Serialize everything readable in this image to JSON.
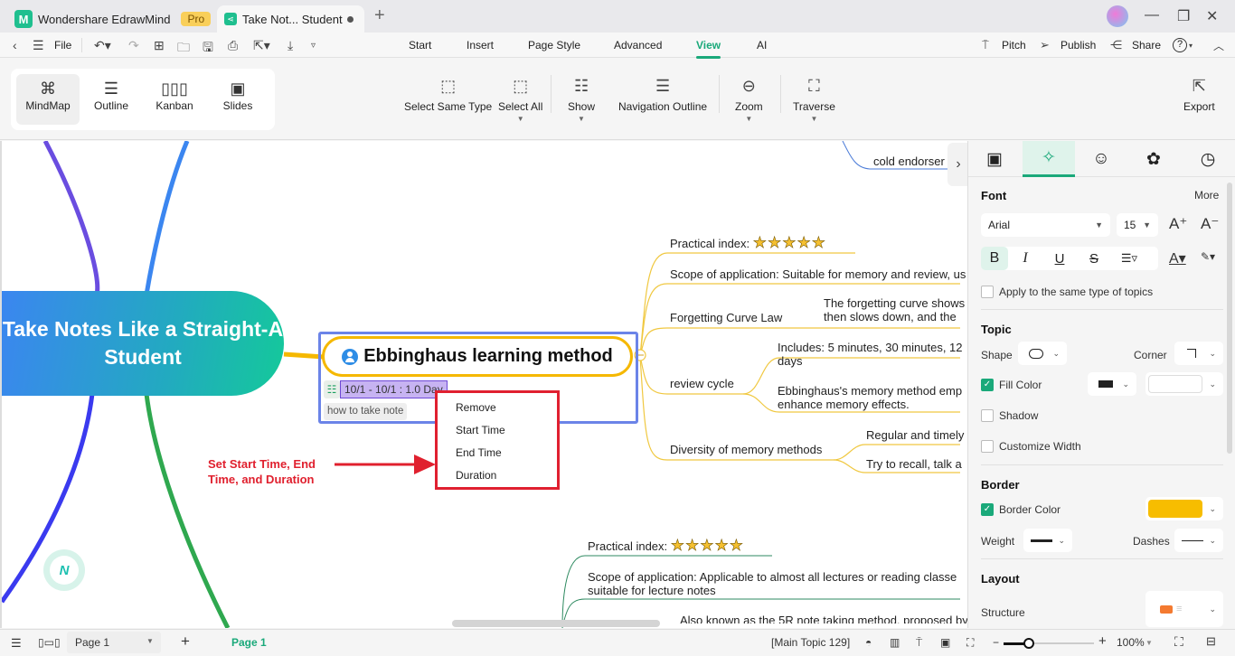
{
  "titlebar": {
    "app_name": "Wondershare EdrawMind",
    "pro_badge": "Pro",
    "doc_tab": "Take Not... Student",
    "new_tab": "+",
    "logo_letter": "M"
  },
  "menubar": {
    "file": "File",
    "tabs": [
      "Start",
      "Insert",
      "Page Style",
      "Advanced",
      "View",
      "AI"
    ],
    "active_tab": "View",
    "right": {
      "pitch": "Pitch",
      "publish": "Publish",
      "share": "Share",
      "help": "?"
    }
  },
  "ribbon": {
    "view_modes": [
      {
        "label": "MindMap",
        "icon": "mindmap-icon",
        "selected": true
      },
      {
        "label": "Outline",
        "icon": "outline-icon"
      },
      {
        "label": "Kanban",
        "icon": "kanban-icon"
      },
      {
        "label": "Slides",
        "icon": "slides-icon"
      }
    ],
    "tools": [
      {
        "label": "Select Same Type",
        "icon": "select-same-type-icon"
      },
      {
        "label": "Select All",
        "icon": "select-all-icon",
        "dropdown": true
      },
      {
        "label": "Show",
        "icon": "show-icon",
        "dropdown": true
      },
      {
        "label": "Navigation Outline",
        "icon": "navigation-outline-icon"
      },
      {
        "label": "Zoom",
        "icon": "zoom-icon",
        "dropdown": true
      },
      {
        "label": "Traverse",
        "icon": "traverse-icon",
        "dropdown": true
      }
    ],
    "export": "Export"
  },
  "canvas": {
    "central_topic": "Take Notes Like a Straight-A Student",
    "main_topic": "Ebbinghaus learning method",
    "date_range": "10/1 - 10/1 : 1.0 Day",
    "note_tag": "how to take note",
    "context_menu": [
      "Remove",
      "Start Time",
      "End Time",
      "Duration"
    ],
    "annotation": "Set Start Time, End Time, and Duration",
    "top_node": "cold endorser",
    "branch1": {
      "practical_label": "Practical index:",
      "rating": 5,
      "scope": "Scope of application: Suitable for memory and review, us",
      "forgetting_curve": "Forgetting Curve Law",
      "forgetting_detail_1": "The forgetting curve shows",
      "forgetting_detail_2": "then slows down, and the",
      "review_cycle": "review cycle",
      "review_detail_a1": "Includes: 5 minutes, 30 minutes, 12",
      "review_detail_a2": "days",
      "review_detail_b1": "Ebbinghaus's memory method emp",
      "review_detail_b2": "enhance memory effects.",
      "diversity": "Diversity of memory methods",
      "diversity_a": "Regular and timely",
      "diversity_b": "Try to recall, talk a"
    },
    "branch2": {
      "practical_label": "Practical index:",
      "rating": 5,
      "scope_1": "Scope of application: Applicable to almost all lectures or reading classe",
      "scope_2": "suitable for lecture notes",
      "partial": "Also known as the 5R note taking method, proposed by"
    },
    "stars_text": "★★★★★"
  },
  "panel": {
    "font_section": "Font",
    "more": "More",
    "font_family": "Arial",
    "font_size": "15",
    "apply_same": "Apply to the same type of topics",
    "topic_section": "Topic",
    "shape_label": "Shape",
    "corner_label": "Corner",
    "fill_color_label": "Fill Color",
    "fill_color_checked": true,
    "shadow_label": "Shadow",
    "customize_width_label": "Customize Width",
    "border_section": "Border",
    "border_color_label": "Border Color",
    "border_color_checked": true,
    "border_color": "#f7bd00",
    "weight_label": "Weight",
    "dashes_label": "Dashes",
    "layout_section": "Layout",
    "structure_label": "Structure"
  },
  "status": {
    "page_select": "Page 1",
    "page_tab": "Page 1",
    "topic_info": "[Main Topic 129]",
    "zoom_level": "100%",
    "zoom_fraction": 0.28
  },
  "colors": {
    "accent": "#1aa97a",
    "central_gradient_start": "#3b86f0",
    "central_gradient_end": "#14c99a",
    "main_border": "#f5b800",
    "selection": "#6b84e8",
    "annotation_red": "#e0202e"
  }
}
